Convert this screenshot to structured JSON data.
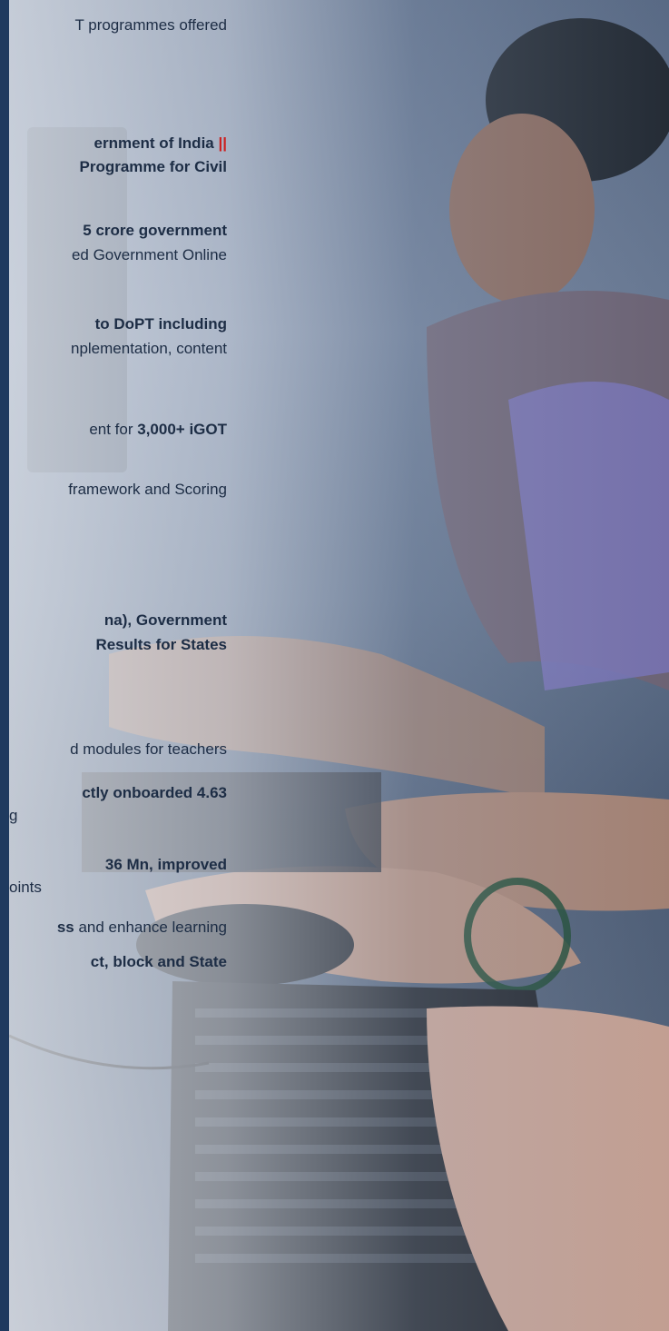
{
  "photo": {
    "icon": "people-at-computers-photo"
  },
  "text_lines": [
    {
      "id": "l1",
      "parts": [
        [
          "T programmes offered",
          "n"
        ]
      ]
    },
    {
      "id": "l2",
      "parts": [
        [
          "ernment of India ",
          "b"
        ],
        [
          "||",
          "r"
        ]
      ]
    },
    {
      "id": "l3",
      "parts": [
        [
          "Programme for Civil",
          "b"
        ]
      ]
    },
    {
      "id": "l4",
      "parts": [
        [
          "5 crore government",
          "b"
        ]
      ]
    },
    {
      "id": "l5",
      "parts": [
        [
          "ed Government Online",
          "n"
        ]
      ]
    },
    {
      "id": "l6",
      "parts": [
        [
          "to DoPT including",
          "b"
        ]
      ]
    },
    {
      "id": "l7",
      "parts": [
        [
          "nplementation, content",
          "n"
        ]
      ]
    },
    {
      "id": "l8",
      "parts": [
        [
          "ent for ",
          "n"
        ],
        [
          "3,000+ iGOT",
          "b"
        ]
      ]
    },
    {
      "id": "l9",
      "parts": [
        [
          "framework and Scoring",
          "n"
        ]
      ]
    },
    {
      "id": "l10",
      "parts": [
        [
          "na), Government",
          "b"
        ]
      ]
    },
    {
      "id": "l11",
      "parts": [
        [
          "Results for States",
          "b"
        ]
      ]
    },
    {
      "id": "l12",
      "parts": [
        [
          "d modules for teachers",
          "n"
        ]
      ]
    },
    {
      "id": "l13",
      "parts": [
        [
          "ctly onboarded 4.63",
          "b"
        ]
      ]
    },
    {
      "id": "l14",
      "parts": [
        [
          "g",
          "n"
        ]
      ]
    },
    {
      "id": "l15",
      "parts": [
        [
          "36 Mn, improved",
          "b"
        ]
      ]
    },
    {
      "id": "l16",
      "parts": [
        [
          "oints",
          "n"
        ]
      ]
    },
    {
      "id": "l17",
      "parts": [
        [
          "ss",
          "b"
        ],
        [
          " and enhance learning",
          "n"
        ]
      ]
    },
    {
      "id": "l18",
      "parts": [
        [
          "ct, block and State",
          "b"
        ]
      ]
    }
  ],
  "colors": {
    "accent_bar": "#1f3a5f",
    "highlight": "#cc1f1f",
    "text": "#1d2d45"
  }
}
